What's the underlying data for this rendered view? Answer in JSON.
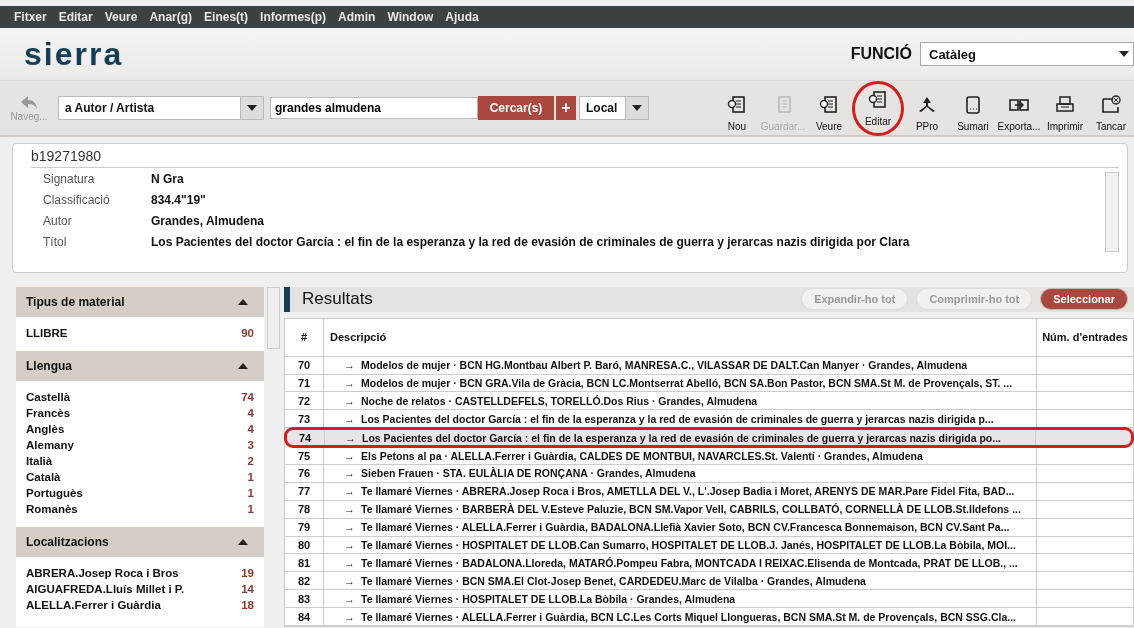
{
  "menu": [
    {
      "label": "Fitxer"
    },
    {
      "label": "Editar"
    },
    {
      "label": "Veure"
    },
    {
      "label": "Anar(g)"
    },
    {
      "label": "Eines(t)"
    },
    {
      "label": "Informes(p)"
    },
    {
      "label": "Admin"
    },
    {
      "label": "Window"
    },
    {
      "label": "Ajuda"
    }
  ],
  "header": {
    "logo": "sierra",
    "function_label": "FUNCIÓ",
    "function_value": "Catàleg"
  },
  "toolbar": {
    "back_label": "Naveg...",
    "index": "a  Autor / Artista",
    "query": "grandes almudena",
    "search_button": "Cercar(s)",
    "plus_button": "+",
    "scope": "Local",
    "tools": [
      {
        "kind": "new",
        "label": "Nou",
        "disabled": false,
        "circled": false
      },
      {
        "kind": "save",
        "label": "Guardar...",
        "disabled": true,
        "circled": false
      },
      {
        "kind": "view",
        "label": "Veure",
        "disabled": false,
        "circled": false
      },
      {
        "kind": "edit",
        "label": "Editar",
        "disabled": false,
        "circled": true
      },
      {
        "kind": "ppro",
        "label": "PPro",
        "disabled": false,
        "circled": false
      },
      {
        "kind": "summary",
        "label": "Sumari",
        "disabled": false,
        "circled": false
      },
      {
        "kind": "export",
        "label": "Exporta...",
        "disabled": false,
        "circled": false
      },
      {
        "kind": "print",
        "label": "Imprimir",
        "disabled": false,
        "circled": false
      },
      {
        "kind": "close",
        "label": "Tancar",
        "disabled": false,
        "circled": false
      }
    ]
  },
  "record": {
    "id": "b19271980",
    "fields": [
      {
        "label": "Signatura",
        "value": "N Gra"
      },
      {
        "label": "Classificació",
        "value": "834.4\"19\""
      },
      {
        "label": "Autor",
        "value": "Grandes, Almudena"
      },
      {
        "label": "Títol",
        "value": "Los Pacientes del doctor García : el fin de la esperanza y la red de evasión de criminales de guerra y jerarcas nazis dirigida por Clara"
      }
    ]
  },
  "facets": [
    {
      "title": "Tipus de material",
      "expanded": true,
      "items": [
        {
          "label": "LLIBRE",
          "count": "90"
        }
      ]
    },
    {
      "title": "Llengua",
      "expanded": true,
      "items": [
        {
          "label": "Castellà",
          "count": "74"
        },
        {
          "label": "Francès",
          "count": "4"
        },
        {
          "label": "Anglès",
          "count": "4"
        },
        {
          "label": "Alemany",
          "count": "3"
        },
        {
          "label": "Italià",
          "count": "2"
        },
        {
          "label": "Català",
          "count": "1"
        },
        {
          "label": "Portuguès",
          "count": "1"
        },
        {
          "label": "Romanès",
          "count": "1"
        }
      ]
    },
    {
      "title": "Localitzacions",
      "expanded": true,
      "items": [
        {
          "label": "ABRERA.Josep Roca i Bros",
          "count": "19"
        },
        {
          "label": "AIGUAFREDA.Lluís Millet i P.",
          "count": "14"
        },
        {
          "label": "ALELLA.Ferrer i Guàrdia",
          "count": "18"
        }
      ]
    }
  ],
  "results": {
    "title": "Resultats",
    "buttons": [
      {
        "label": "Expandir-ho tot",
        "disabled": true
      },
      {
        "label": "Comprimir-ho tot",
        "disabled": true
      },
      {
        "label": "Seleccionar",
        "disabled": false
      }
    ],
    "columns": [
      "#",
      "Descripció",
      "Núm. d'entrades"
    ],
    "rows": [
      {
        "num": "70",
        "arrow": "→",
        "text": "Modelos de mujer · BCN HG.Montbau Albert P. Baró, MANRESA.C., VILASSAR DE DALT.Can Manyer · Grandes, Almudena",
        "selected": false,
        "circled": false
      },
      {
        "num": "71",
        "arrow": "→",
        "text": "Modelos de mujer · BCN GRA.Vila de Gràcia, BCN LC.Montserrat Abelló, BCN SA.Bon Pastor, BCN SMA.St M. de Provençals, ST. ...",
        "selected": false,
        "circled": false
      },
      {
        "num": "72",
        "arrow": "→",
        "text": "Noche de relatos · CASTELLDEFELS, TORELLÓ.Dos Rius · Grandes, Almudena",
        "selected": false,
        "circled": false
      },
      {
        "num": "73",
        "arrow": "→",
        "text": "Los Pacientes del doctor García : el fin de la esperanza y la red de evasión de criminales de guerra y jerarcas nazis dirigida p...",
        "selected": false,
        "circled": false
      },
      {
        "num": "74",
        "arrow": "→",
        "text": "Los Pacientes del doctor García : el fin de la esperanza y la red de evasión de criminales de guerra y jerarcas nazis dirigida po...",
        "selected": true,
        "circled": true
      },
      {
        "num": "75",
        "arrow": "→",
        "text": "Els Petons al pa · ALELLA.Ferrer i Guàrdia, CALDES DE MONTBUI, NAVARCLES.St. Valentí · Grandes, Almudena",
        "selected": false,
        "circled": false
      },
      {
        "num": "76",
        "arrow": "→",
        "text": "Sieben Frauen · STA. EULÀLIA DE RONÇANA · Grandes, Almudena",
        "selected": false,
        "circled": false
      },
      {
        "num": "77",
        "arrow": "→",
        "text": "Te llamaré Viernes · ABRERA.Josep Roca i Bros, AMETLLA DEL V., L'.Josep Badia i Moret, ARENYS DE MAR.Pare Fidel Fita, BAD...",
        "selected": false,
        "circled": false
      },
      {
        "num": "78",
        "arrow": "→",
        "text": "Te llamaré Viernes · BARBERÀ DEL V.Esteve Paluzie, BCN SM.Vapor Vell, CABRILS, COLLBATÓ, CORNELLÀ DE LLOB.St.Ildefons ...",
        "selected": false,
        "circled": false
      },
      {
        "num": "79",
        "arrow": "→",
        "text": "Te llamaré Viernes · ALELLA.Ferrer i Guàrdia, BADALONA.Llefià Xavier Soto, BCN CV.Francesca Bonnemaison, BCN CV.Sant Pa...",
        "selected": false,
        "circled": false
      },
      {
        "num": "80",
        "arrow": "→",
        "text": "Te llamaré Viernes · HOSPITALET DE LLOB.Can Sumarro, HOSPITALET DE LLOB.J. Janés, HOSPITALET DE LLOB.La Bòbila, MOI...",
        "selected": false,
        "circled": false
      },
      {
        "num": "81",
        "arrow": "→",
        "text": "Te llamaré Viernes · BADALONA.Lloreda, MATARÓ.Pompeu Fabra, MONTCADA I REIXAC.Elisenda de Montcada, PRAT DE LLOB., ...",
        "selected": false,
        "circled": false
      },
      {
        "num": "82",
        "arrow": "→",
        "text": "Te llamaré Viernes · BCN SMA.El Clot-Josep Benet, CARDEDEU.Marc de Vilalba · Grandes, Almudena",
        "selected": false,
        "circled": false
      },
      {
        "num": "83",
        "arrow": "→",
        "text": "Te llamaré Viernes · HOSPITALET DE LLOB.La Bòbila · Grandes, Almudena",
        "selected": false,
        "circled": false
      },
      {
        "num": "84",
        "arrow": "→",
        "text": "Te llamaré Viernes · ALELLA.Ferrer i Guàrdia, BCN LC.Les Corts Miquel Llongueras, BCN SMA.St M. de Provençals, BCN SSG.Cla...",
        "selected": false,
        "circled": false
      }
    ]
  }
}
